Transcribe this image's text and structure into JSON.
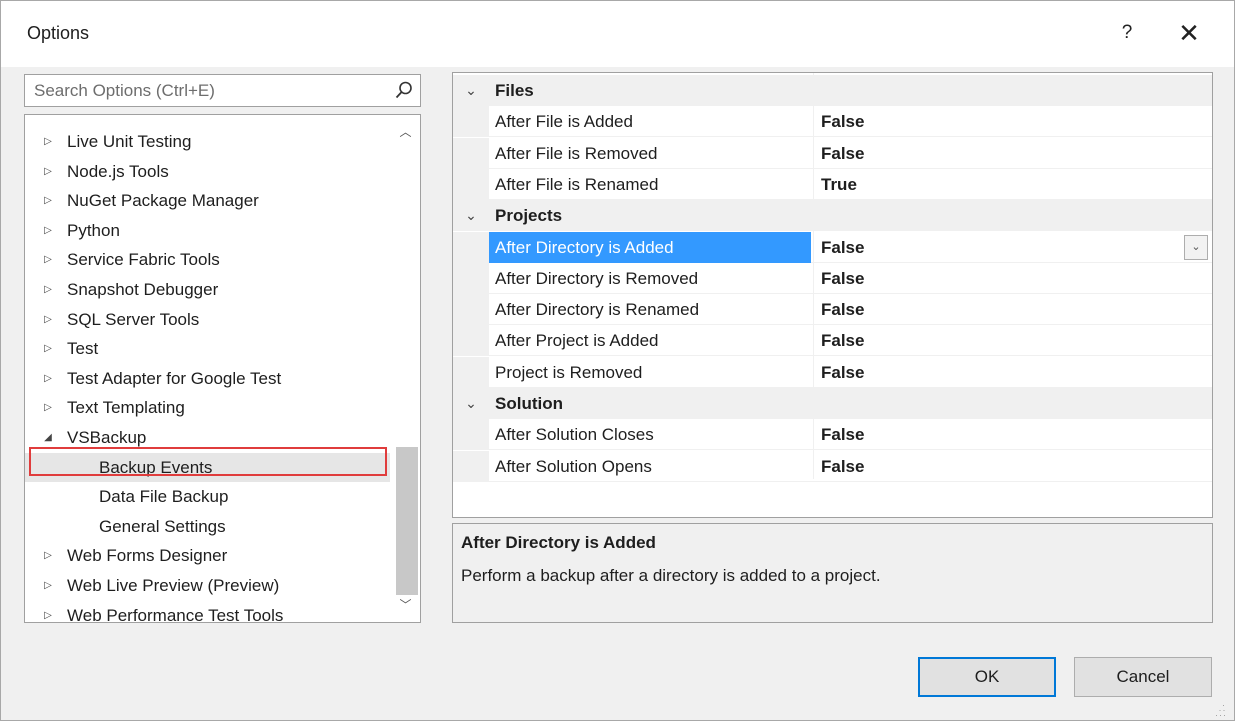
{
  "window": {
    "title": "Options",
    "help_label": "?",
    "close_label": "✕"
  },
  "search": {
    "placeholder": "Search Options (Ctrl+E)",
    "value": ""
  },
  "tree": {
    "items": [
      {
        "label": "Live Unit Testing",
        "expander": "collapsed"
      },
      {
        "label": "Node.js Tools",
        "expander": "collapsed"
      },
      {
        "label": "NuGet Package Manager",
        "expander": "collapsed"
      },
      {
        "label": "Python",
        "expander": "collapsed"
      },
      {
        "label": "Service Fabric Tools",
        "expander": "collapsed"
      },
      {
        "label": "Snapshot Debugger",
        "expander": "collapsed"
      },
      {
        "label": "SQL Server Tools",
        "expander": "collapsed"
      },
      {
        "label": "Test",
        "expander": "collapsed"
      },
      {
        "label": "Test Adapter for Google Test",
        "expander": "collapsed"
      },
      {
        "label": "Text Templating",
        "expander": "collapsed"
      },
      {
        "label": "VSBackup",
        "expander": "expanded"
      },
      {
        "label": "Backup Events",
        "expander": "none",
        "selected": true
      },
      {
        "label": "Data File Backup",
        "expander": "none"
      },
      {
        "label": "General Settings",
        "expander": "none"
      },
      {
        "label": "Web Forms Designer",
        "expander": "collapsed"
      },
      {
        "label": "Web Live Preview (Preview)",
        "expander": "collapsed"
      },
      {
        "label": "Web Performance Test Tools",
        "expander": "collapsed"
      }
    ],
    "collapsed_glyph": "▷",
    "expanded_glyph": "◢"
  },
  "property_grid": {
    "categories": [
      {
        "name": "Files",
        "properties": [
          {
            "name": "After File is Added",
            "value": "False"
          },
          {
            "name": "After File is Removed",
            "value": "False"
          },
          {
            "name": "After File is Renamed",
            "value": "True"
          }
        ]
      },
      {
        "name": "Projects",
        "properties": [
          {
            "name": "After Directory is Added",
            "value": "False",
            "active": true
          },
          {
            "name": "After Directory is Removed",
            "value": "False"
          },
          {
            "name": "After Directory is Renamed",
            "value": "False"
          },
          {
            "name": "After Project is Added",
            "value": "False"
          },
          {
            "name": "Project is Removed",
            "value": "False"
          }
        ]
      },
      {
        "name": "Solution",
        "properties": [
          {
            "name": "After Solution Closes",
            "value": "False"
          },
          {
            "name": "After Solution Opens",
            "value": "False"
          }
        ]
      }
    ]
  },
  "description": {
    "title": "After Directory is Added",
    "text": "Perform a backup after a directory is added to a project."
  },
  "buttons": {
    "ok": "OK",
    "cancel": "Cancel"
  },
  "colors": {
    "selection": "#3399ff",
    "highlight_border": "#e03c3c",
    "default_button_border": "#0078d7"
  }
}
